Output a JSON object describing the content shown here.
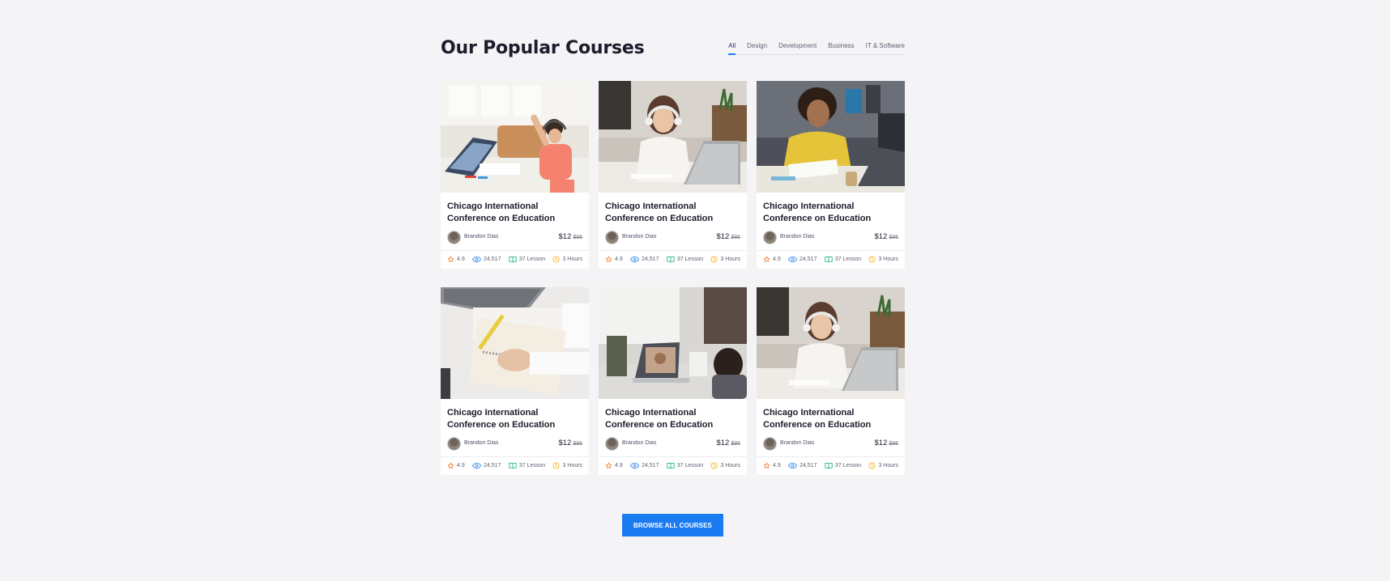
{
  "section": {
    "title": "Our Popular Courses",
    "tabs": [
      {
        "label": "All",
        "active": true
      },
      {
        "label": "Design",
        "active": false
      },
      {
        "label": "Development",
        "active": false
      },
      {
        "label": "Business",
        "active": false
      },
      {
        "label": "IT & Software",
        "active": false
      }
    ]
  },
  "courses": [
    {
      "image": "girl-laptop-classroom",
      "title": "Chicago International Conference on Education",
      "author": "Brandon Dias",
      "price": "$12",
      "old_price": "$95",
      "rating": "4.9",
      "views": "24,517",
      "lessons": "37 Lesson",
      "duration": "3 Hours"
    },
    {
      "image": "woman-headphones-laptop",
      "title": "Chicago International Conference on Education",
      "author": "Brandon Dias",
      "price": "$12",
      "old_price": "$95",
      "rating": "4.9",
      "views": "24,517",
      "lessons": "37 Lesson",
      "duration": "3 Hours"
    },
    {
      "image": "man-yellow-shirt-laptop",
      "title": "Chicago International Conference on Education",
      "author": "Brandon Dias",
      "price": "$12",
      "old_price": "$95",
      "rating": "4.9",
      "views": "24,517",
      "lessons": "37 Lesson",
      "duration": "3 Hours"
    },
    {
      "image": "hands-writing-notebook",
      "title": "Chicago International Conference on Education",
      "author": "Brandon Dias",
      "price": "$12",
      "old_price": "$95",
      "rating": "4.9",
      "views": "24,517",
      "lessons": "37 Lesson",
      "duration": "3 Hours"
    },
    {
      "image": "child-video-call",
      "title": "Chicago International Conference on Education",
      "author": "Brandon Dias",
      "price": "$12",
      "old_price": "$95",
      "rating": "4.9",
      "views": "24,517",
      "lessons": "37 Lesson",
      "duration": "3 Hours"
    },
    {
      "image": "woman-headphones-laptop",
      "title": "Chicago International Conference on Education",
      "author": "Brandon Dias",
      "price": "$12",
      "old_price": "$95",
      "rating": "4.9",
      "views": "24,517",
      "lessons": "37 Lesson",
      "duration": "3 Hours"
    }
  ],
  "browse_button": "BROWSE ALL COURSES",
  "colors": {
    "accent": "#1b7cf2",
    "star": "#f0883e",
    "views": "#3a8fe8",
    "lessons": "#22b38a",
    "clock": "#f3b428",
    "background": "#f4f4f7"
  },
  "icons": {
    "rating": "star-icon",
    "views": "eye-icon",
    "lessons": "book-icon",
    "duration": "clock-icon"
  }
}
